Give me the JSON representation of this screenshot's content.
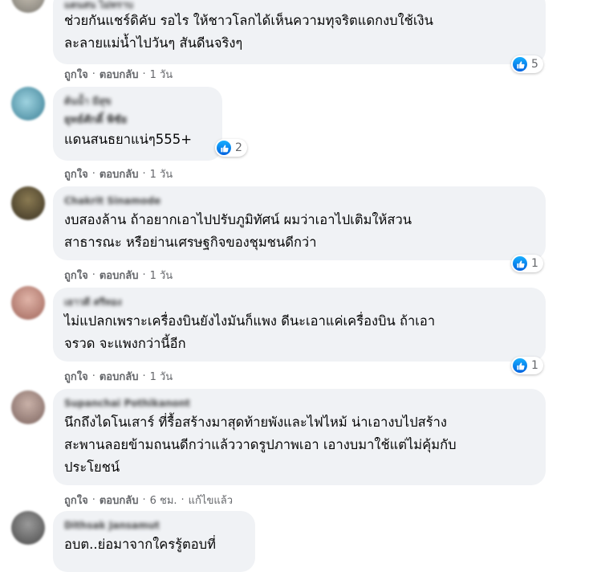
{
  "labels": {
    "like": "ถูกใจ",
    "reply": "ตอบกลับ",
    "dot": "·",
    "edited": "แก้ไขแล้ว"
  },
  "comments": [
    {
      "author": "แดนสน ไม่ทราบ",
      "text": "ช่วยกันแชร์ดิคับ รอไร ให้ชาวโลกได้เห็นความทุจริตแดกงบใช้เงิน\nละลายแม่น้ำไปวันๆ สันดีนจริงๆ",
      "time": "1 วัน",
      "reactions": "5"
    },
    {
      "author": "ต้นน้ำ มีสุข",
      "author_line2": "ยุทธ์ศักดิ์ พิชัย",
      "text": "แดนสนธยาแน่ๆ555+",
      "time": "1 วัน",
      "reactions": "2"
    },
    {
      "author": "Chakrit Sinamode",
      "text": "งบสองล้าน ถ้าอยากเอาไปปรับภูมิทัศน์ ผมว่าเอาไปเติมให้สวน\nสาธารณะ หรือย่านเศรษฐกิจของชุมชนดีกว่า",
      "time": "1 วัน",
      "reactions": "1"
    },
    {
      "author": "เยาวดี ศรีทอง",
      "text": "ไม่แปลกเพราะเครื่องบินยังไงมันก็แพง ดีนะเอาแค่เครื่องบิน ถ้าเอา\nจรวด จะแพงกว่านี้อีก",
      "time": "1 วัน",
      "reactions": "1"
    },
    {
      "author": "Supanchai Pothikanont",
      "text": "นึกถึงไดโนเสาร์ ที่รื้อสร้างมาสุดท้ายพังและไฟไหม้ น่าเอางบไปสร้าง\nสะพานลอยข้ามถนนดีกว่าแล้ววาดรูปภาพเอา เอางบมาใช้แต่ไม่คุ้มกับ\nประโยชน์",
      "time": "6 ชม.",
      "edited": true
    },
    {
      "author": "Dithsak Jansamut",
      "text": "อบต..ย่อมาจากใครรู้ตอบที่"
    }
  ],
  "colors": {
    "bubble": "#f0f2f5",
    "meta": "#65676b",
    "like_blue": "#1877f2"
  },
  "icons": {
    "reaction": "like-thumb-icon"
  }
}
